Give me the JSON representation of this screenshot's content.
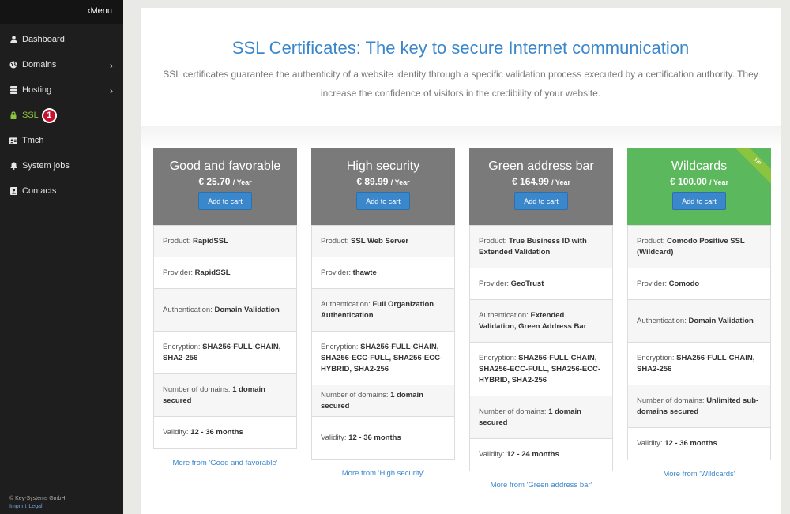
{
  "sidebar": {
    "menu_label": "Menu",
    "items": [
      {
        "label": "Dashboard",
        "icon": "user-icon"
      },
      {
        "label": "Domains",
        "icon": "globe-icon"
      },
      {
        "label": "Hosting",
        "icon": "database-icon"
      },
      {
        "label": "SSL",
        "icon": "lock-icon",
        "badge": "1"
      },
      {
        "label": "Tmch",
        "icon": "id-card-icon"
      },
      {
        "label": "System jobs",
        "icon": "bell-icon"
      },
      {
        "label": "Contacts",
        "icon": "address-book-icon"
      }
    ],
    "footer": {
      "copyright": "© Key-Systems GmbH",
      "imprint": "Imprint",
      "legal": "Legal"
    }
  },
  "page": {
    "title": "SSL Certificates: The key to secure Internet communication",
    "description": "SSL certificates guarantee the authenticity of a website identity through a specific validation process executed by a certification authority. They increase the confidence of visitors in the credibility of your website."
  },
  "labels": {
    "product": "Product:",
    "provider": "Provider:",
    "authentication": "Authentication:",
    "encryption": "Encryption:",
    "domains": "Number of domains:",
    "validity": "Validity:",
    "per_year": "/ Year",
    "add_to_cart": "Add to cart",
    "tip": "TIP"
  },
  "cards": [
    {
      "name": "Good and favorable",
      "price": "€ 25.70",
      "product": "RapidSSL",
      "provider": "RapidSSL",
      "authentication": "Domain Validation",
      "encryption": "SHA256-FULL-CHAIN, SHA2-256",
      "domains": "1 domain secured",
      "validity": "12 - 36 months",
      "more": "More from 'Good and favorable'"
    },
    {
      "name": "High security",
      "price": "€ 89.99",
      "product": "SSL Web Server",
      "provider": "thawte",
      "authentication": "Full Organization Authentication",
      "encryption": "SHA256-FULL-CHAIN, SHA256-ECC-FULL, SHA256-ECC-HYBRID, SHA2-256",
      "domains": "1 domain secured",
      "validity": "12 - 36 months",
      "more": "More from 'High security'"
    },
    {
      "name": "Green address bar",
      "price": "€ 164.99",
      "product": "True Business ID with Extended Validation",
      "provider": "GeoTrust",
      "authentication": "Extended Validation, Green Address Bar",
      "encryption": "SHA256-FULL-CHAIN, SHA256-ECC-FULL, SHA256-ECC-HYBRID, SHA2-256",
      "domains": "1 domain secured",
      "validity": "12 - 24 months",
      "more": "More from 'Green address bar'"
    },
    {
      "name": "Wildcards",
      "price": "€ 100.00",
      "product": "Comodo Positive SSL (Wildcard)",
      "provider": "Comodo",
      "authentication": "Domain Validation",
      "encryption": "SHA256-FULL-CHAIN, SHA2-256",
      "domains": "Unlimited sub-domains secured",
      "validity": "12 - 36 months",
      "more": "More from 'Wildcards'"
    }
  ],
  "colors": {
    "accent": "#3b87cc",
    "card_head": "#7a7a7a",
    "card_head_tip": "#5cb85c",
    "active_nav": "#8cc63f",
    "badge": "#c8102e"
  }
}
